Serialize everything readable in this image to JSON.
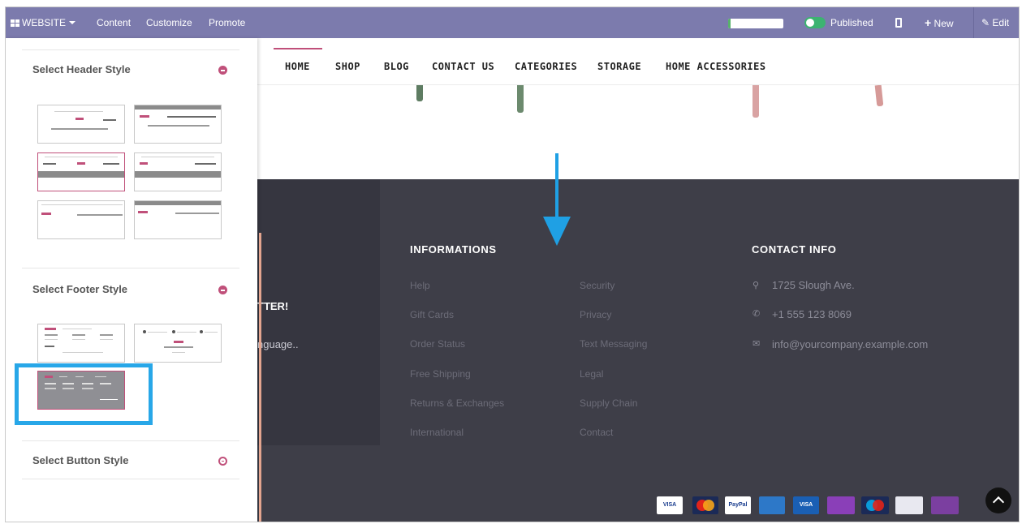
{
  "topbar": {
    "website_label": "WEBSITE",
    "content_label": "Content",
    "customize_label": "Customize",
    "promote_label": "Promote",
    "progress_fraction": 0.05,
    "published_label": "Published",
    "new_label": "New",
    "edit_label": "Edit"
  },
  "sidebar": {
    "header_section_title": "Select Header Style",
    "footer_section_title": "Select Footer Style",
    "button_section_title": "Select Button Style"
  },
  "nav": {
    "items": [
      "HOME",
      "SHOP",
      "BLOG",
      "CONTACT US",
      "CATEGORIES",
      "STORAGE",
      "HOME ACCESSORIES"
    ]
  },
  "footer": {
    "partial_heading": "TTER!",
    "partial_text": "nguage..",
    "informations_heading": "INFORMATIONS",
    "links_col1": [
      "Help",
      "Gift Cards",
      "Order Status",
      "Free Shipping",
      "Returns & Exchanges",
      "International"
    ],
    "links_col2": [
      "Security",
      "Privacy",
      "Text Messaging",
      "Legal",
      "Supply Chain",
      "Contact"
    ],
    "contact_heading": "CONTACT INFO",
    "address": "1725 Slough Ave.",
    "phone": "+1 555 123 8069",
    "email": "info@yourcompany.example.com"
  },
  "payments": [
    "VISA",
    "",
    "PayPal",
    "",
    "VISA",
    "",
    "",
    "",
    ""
  ],
  "colors": {
    "topbar": "#7c7bad",
    "accent_pink": "#c0507a",
    "highlight_blue": "#28a7e8",
    "footer_bg": "#3e3e48"
  }
}
